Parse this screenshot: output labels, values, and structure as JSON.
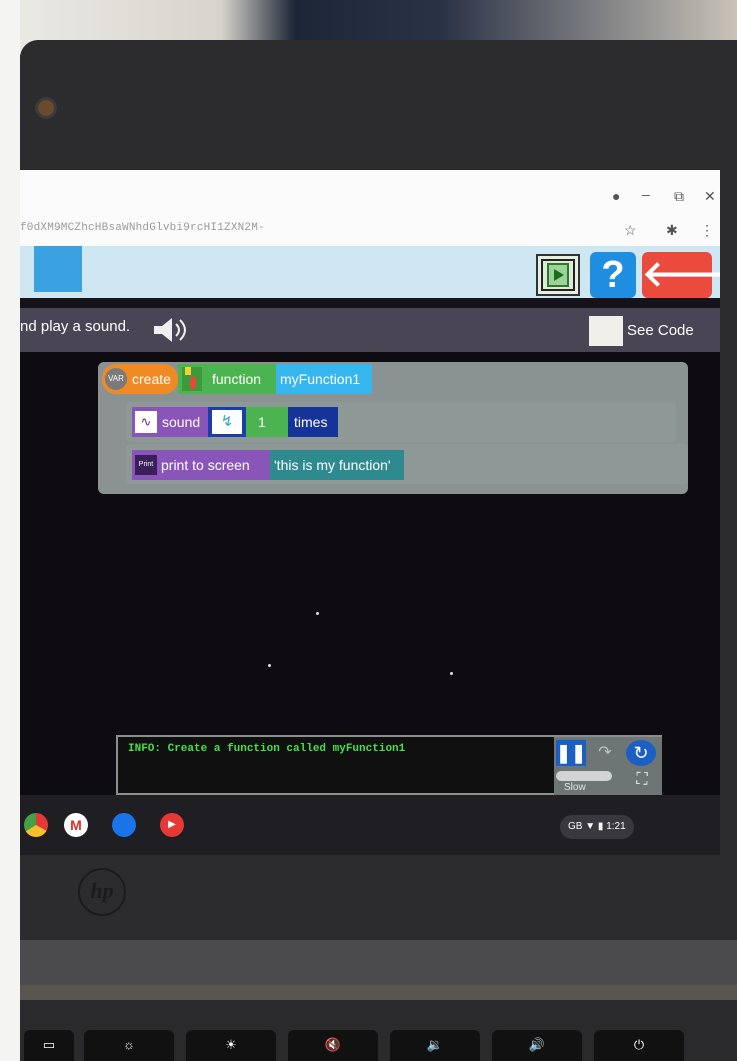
{
  "browser": {
    "url_fragment": "f0dXM9MCZhcHBsaWNhdGlvbi9rcHI1ZXN2M-",
    "icons": [
      "location-icon",
      "minimize-icon",
      "restore-icon",
      "close-icon",
      "star-icon",
      "extension-icon",
      "menu-icon"
    ]
  },
  "app": {
    "header": {
      "play_icon": "film-play-icon",
      "help_label": "?",
      "back_icon": "arrow-left-icon"
    },
    "instruction": {
      "text": "nd play a sound.",
      "see_code_label": "See Code"
    },
    "blocks": {
      "create_label": "create",
      "function_label": "function",
      "function_name": "myFunction1",
      "sound_label": "sound",
      "sound_count": "1",
      "times_label": "times",
      "print_label": "print to screen",
      "print_value": "'this is my function'"
    },
    "console": {
      "info_text": "INFO: Create a function called myFunction1",
      "speed_label": "Slow"
    }
  },
  "taskbar": {
    "keyboard": "GB",
    "time": "1:21"
  },
  "device": {
    "brand": "hp"
  },
  "colors": {
    "create_block": "#f08a24",
    "function_block": "#4bb34f",
    "name_block": "#35b6ef",
    "sound_block": "#8a55b8",
    "times_block": "#16339a",
    "print_block": "#8a55b8",
    "string_block": "#2e8a8f",
    "console_text": "#46e04a"
  }
}
